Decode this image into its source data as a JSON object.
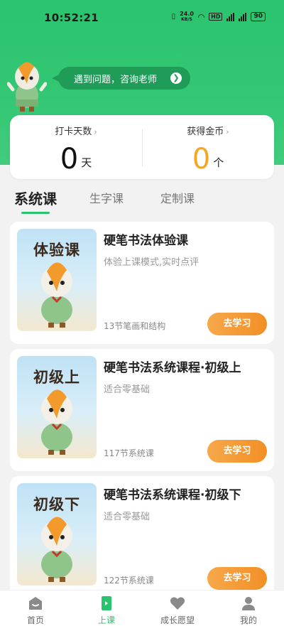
{
  "status_bar": {
    "time": "10:52:21",
    "speed": "24.0",
    "speed_unit": "KB/S",
    "network": "HD",
    "battery": "90"
  },
  "header": {
    "ask_teacher": "遇到问题，咨询老师"
  },
  "stats": {
    "checkin": {
      "label": "打卡天数",
      "value": "0",
      "unit": "天"
    },
    "coins": {
      "label": "获得金币",
      "value": "0",
      "unit": "个"
    }
  },
  "tabs": [
    {
      "label": "系统课",
      "active": true
    },
    {
      "label": "生字课",
      "active": false
    },
    {
      "label": "定制课",
      "active": false
    }
  ],
  "courses": [
    {
      "thumb_label": "体验课",
      "title": "硬笔书法体验课",
      "subtitle": "体验上课模式,实时点评",
      "meta": "13节笔画和结构",
      "button": "去学习"
    },
    {
      "thumb_label": "初级上",
      "title": "硬笔书法系统课程·初级上",
      "subtitle": "适合零基础",
      "meta": "117节系统课",
      "button": "去学习"
    },
    {
      "thumb_label": "初级下",
      "title": "硬笔书法系统课程·初级下",
      "subtitle": "适合零基础",
      "meta": "122节系统课",
      "button": "去学习"
    }
  ],
  "bottom_nav": [
    {
      "label": "首页",
      "icon": "home-icon",
      "active": false
    },
    {
      "label": "上课",
      "icon": "book-icon",
      "active": true
    },
    {
      "label": "成长愿望",
      "icon": "heart-icon",
      "active": false
    },
    {
      "label": "我的",
      "icon": "profile-icon",
      "active": false
    }
  ],
  "colors": {
    "brand_green": "#2bc46e",
    "coin_orange": "#f5a623",
    "button_orange": "#f28f25"
  }
}
